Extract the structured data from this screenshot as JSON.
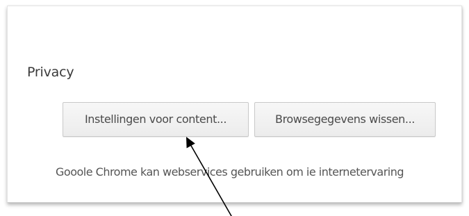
{
  "privacy": {
    "title": "Privacy",
    "content_settings_label": "Instellingen voor content...",
    "clear_browsing_label": "Browsegegevens wissen...",
    "description": "Gooole Chrome kan webservices gebruiken om ie internetervaring"
  },
  "annotation": {
    "arrow_icon": "pointer-arrow-icon",
    "arrow_color": "#000000"
  }
}
